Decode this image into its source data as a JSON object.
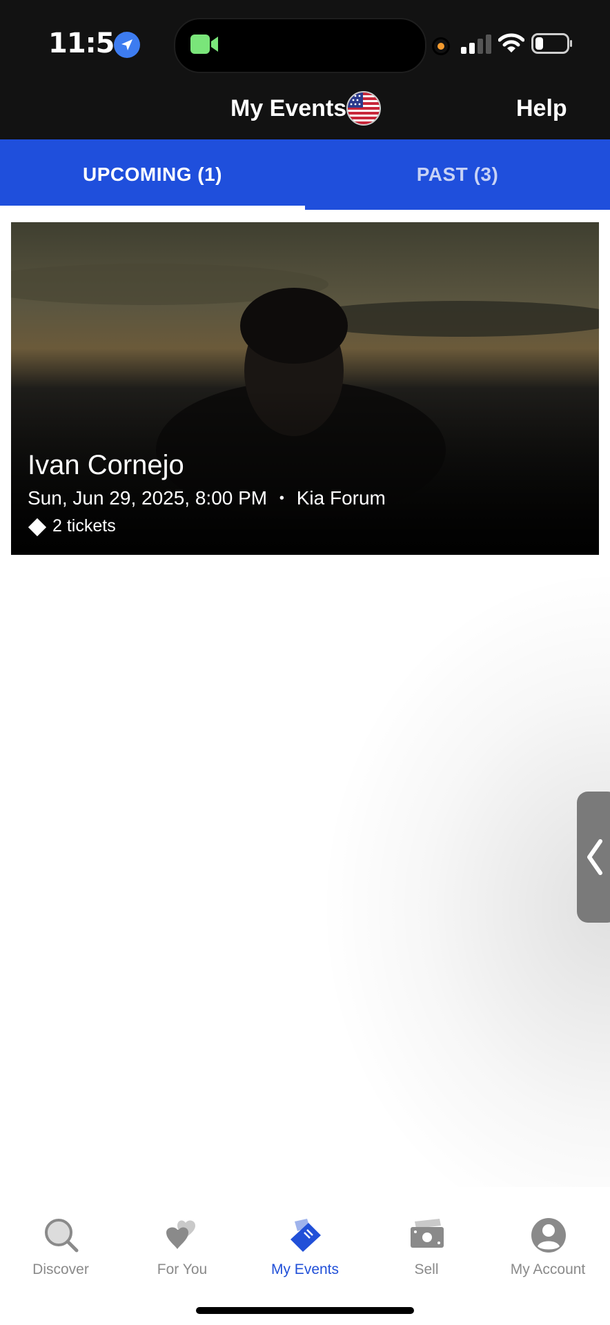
{
  "status_bar": {
    "time": "11:54"
  },
  "header": {
    "title": "My Events",
    "help_label": "Help"
  },
  "tabs": [
    {
      "label": "UPCOMING (1)",
      "active": true
    },
    {
      "label": "PAST (3)",
      "active": false
    }
  ],
  "event": {
    "name": "Ivan Cornejo",
    "date_time": "Sun, Jun 29, 2025, 8:00 PM",
    "separator": "•",
    "venue": "Kia Forum",
    "tickets": "2 tickets"
  },
  "bottom_nav": [
    {
      "label": "Discover",
      "icon": "search-icon",
      "active": false
    },
    {
      "label": "For You",
      "icon": "hearts-icon",
      "active": false
    },
    {
      "label": "My Events",
      "icon": "tickets-icon",
      "active": true
    },
    {
      "label": "Sell",
      "icon": "money-icon",
      "active": false
    },
    {
      "label": "My Account",
      "icon": "account-icon",
      "active": false
    }
  ],
  "colors": {
    "header_bg": "#121212",
    "tab_bg": "#1f4fdc",
    "active_nav": "#2150d8",
    "inactive_nav": "#8a8a8a"
  }
}
